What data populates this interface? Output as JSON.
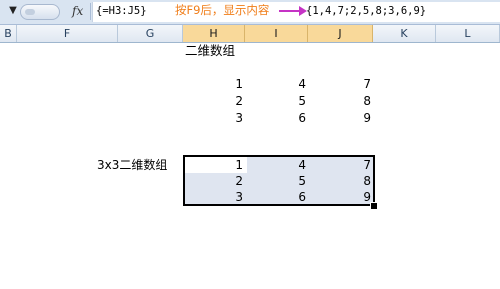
{
  "formula_bar": {
    "namebox_dropdown": "▼",
    "fx_label": "fx",
    "formula": "{=H3:J5}",
    "annotation": "按F9后，显示内容",
    "result": "{1,4,7;2,5,8;3,6,9}"
  },
  "columns": [
    {
      "label": "B",
      "selected": false
    },
    {
      "label": "F",
      "selected": false
    },
    {
      "label": "G",
      "selected": false
    },
    {
      "label": "H",
      "selected": true
    },
    {
      "label": "I",
      "selected": true
    },
    {
      "label": "J",
      "selected": true
    },
    {
      "label": "K",
      "selected": false
    },
    {
      "label": "L",
      "selected": false
    }
  ],
  "sheet": {
    "array_title": "二维数组",
    "grid_top": [
      [
        "1",
        "4",
        "7"
      ],
      [
        "2",
        "5",
        "8"
      ],
      [
        "3",
        "6",
        "9"
      ]
    ],
    "range_label": "3x3二维数组",
    "grid_bottom": [
      [
        "1",
        "4",
        "7"
      ],
      [
        "2",
        "5",
        "8"
      ],
      [
        "3",
        "6",
        "9"
      ]
    ]
  },
  "colors": {
    "annotation": "#f07d18",
    "arrow": "#c533c5",
    "selected_header": "#f9d99a",
    "selection_fill": "#dfe5f0"
  }
}
